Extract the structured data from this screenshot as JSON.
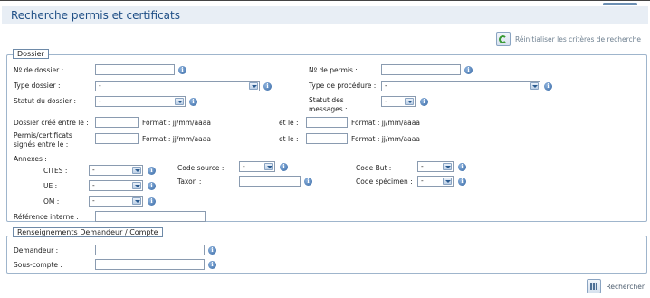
{
  "page": {
    "title": "Recherche permis et certificats"
  },
  "reset_label": "Réinitialiser les critères de recherche",
  "search_label": "Rechercher",
  "dossier": {
    "legend": "Dossier",
    "no_dossier_label": "Nº de dossier :",
    "no_permis_label": "Nº de permis :",
    "type_dossier_label": "Type dossier :",
    "type_dossier_value": "-",
    "type_procedure_label": "Type de procédure :",
    "type_procedure_value": "-",
    "statut_dossier_label": "Statut du dossier :",
    "statut_dossier_value": "-",
    "statut_messages_label_1": "Statut des",
    "statut_messages_label_2": "messages :",
    "statut_messages_value": "-",
    "cree_label": "Dossier créé entre le :",
    "format_label": "Format : jj/mm/aaaa",
    "et_le_label": "et le :",
    "signes_label_1": "Permis/certificats",
    "signes_label_2": "signés entre le :",
    "annexes_label": "Annexes :",
    "cites_label": "CITES :",
    "cites_value": "-",
    "ue_label": "UE :",
    "ue_value": "-",
    "om_label": "OM :",
    "om_value": "-",
    "code_source_label": "Code source :",
    "code_source_value": "-",
    "taxon_label": "Taxon :",
    "code_but_label": "Code But :",
    "code_but_value": "-",
    "code_specimen_label": "Code spécimen :",
    "code_specimen_value": "-",
    "reference_label": "Référence interne :"
  },
  "demandeur": {
    "legend": "Renseignements Demandeur / Compte",
    "demandeur_label": "Demandeur :",
    "sous_compte_label": "Sous-compte :"
  },
  "icons": {
    "info": "i"
  }
}
